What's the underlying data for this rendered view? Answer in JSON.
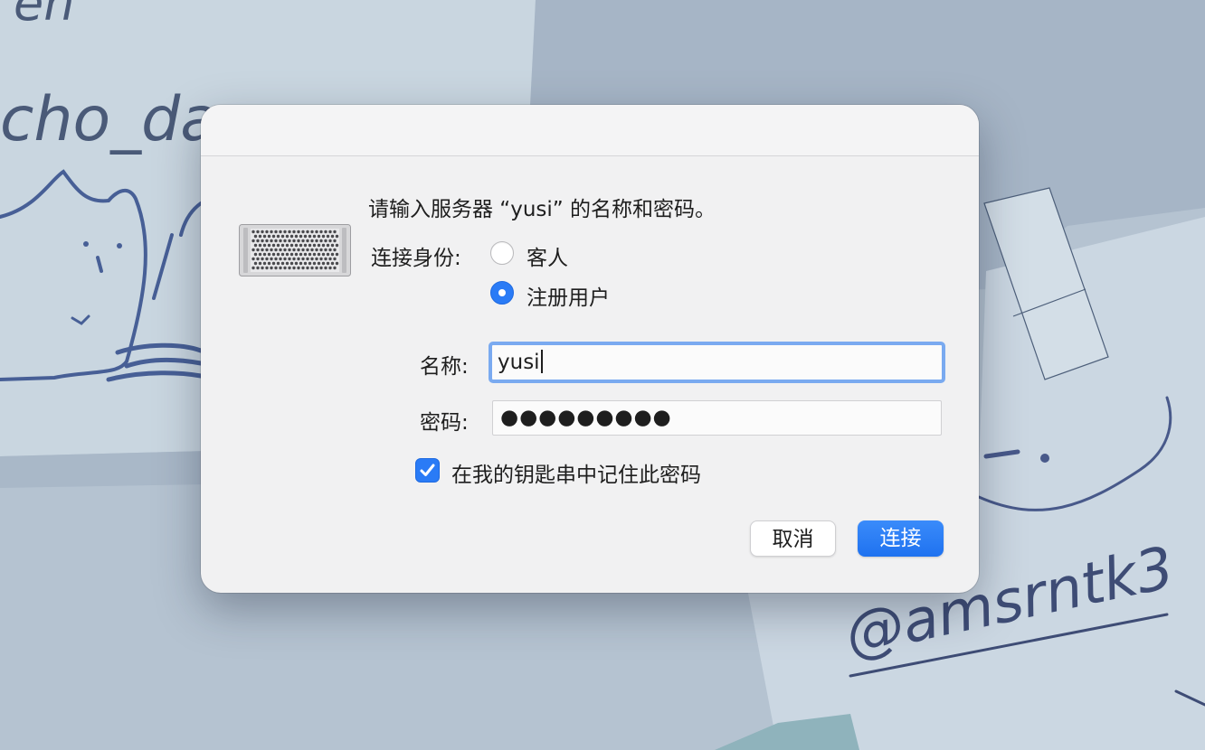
{
  "dialog": {
    "prompt": "请输入服务器 “yusi” 的名称和密码。",
    "connect_as_label": "连接身份:",
    "radio_options": [
      {
        "label": "客人",
        "selected": false
      },
      {
        "label": "注册用户",
        "selected": true
      }
    ],
    "name_label": "名称:",
    "name_value": "yusi",
    "password_label": "密码:",
    "password_value": "●●●●●●●●●",
    "remember_label": "在我的钥匙串中记住此密码",
    "remember_checked": true,
    "cancel_label": "取消",
    "connect_label": "连接"
  },
  "wallpaper": {
    "text_top": "cho_da",
    "text_top_partial": "en",
    "signature": "@amsrntk3"
  },
  "icons": {
    "server": "server-icon",
    "checkmark": "checkmark-icon"
  },
  "colors": {
    "accent": "#2a7bf6",
    "focus_ring": "#7aaaf0",
    "dialog_bg": "#f1f1f2"
  }
}
